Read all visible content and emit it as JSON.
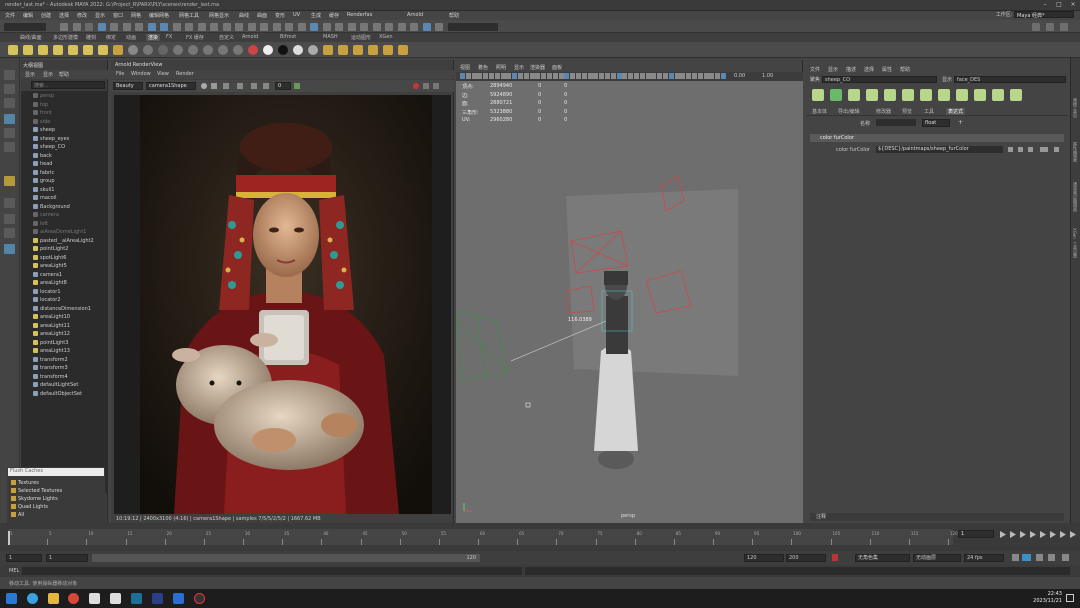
{
  "window": {
    "title": "render_last.ma* - Autodesk MAYA 2022: G:\\Project_R\\PARX\\PLY\\scenes\\render_last.ma"
  },
  "menu": [
    "文件",
    "编辑",
    "创建",
    "选择",
    "修改",
    "显示",
    "窗口",
    "网格",
    "编辑网格",
    "网格工具",
    "网格显示",
    "曲线",
    "曲面",
    "变形",
    "UV",
    "生成",
    "缓存",
    "Renderfax",
    "Arnold",
    "帮助"
  ],
  "workspace": {
    "label": "工作区:",
    "value": "Maya 经典*"
  },
  "shelf_tabs": [
    {
      "label": "曲线/曲面"
    },
    {
      "label": "多边形建模"
    },
    {
      "label": "雕刻"
    },
    {
      "label": "绑定"
    },
    {
      "label": "动画"
    },
    {
      "label": "渲染",
      "active": true
    },
    {
      "label": "FX"
    },
    {
      "label": "FX 缓存"
    },
    {
      "label": "自定义"
    },
    {
      "label": "Arnold"
    },
    {
      "label": "Bifrost"
    },
    {
      "label": "MASH"
    },
    {
      "label": "运动图形"
    },
    {
      "label": "XGen"
    }
  ],
  "outliner": {
    "title": "大纲视图",
    "menu": [
      "显示",
      "显示",
      "帮助"
    ],
    "search_placeholder": "搜索...",
    "items": [
      {
        "name": "persp",
        "dim": true,
        "color": "#666"
      },
      {
        "name": "top",
        "dim": true,
        "color": "#666"
      },
      {
        "name": "front",
        "dim": true,
        "color": "#666"
      },
      {
        "name": "side",
        "dim": true,
        "color": "#666"
      },
      {
        "name": "sheep",
        "color": "#8aa0b8"
      },
      {
        "name": "sheep_eyes",
        "color": "#8aa0b8"
      },
      {
        "name": "sheep_CO",
        "color": "#8aa0b8"
      },
      {
        "name": "back",
        "color": "#8aa0b8"
      },
      {
        "name": "head",
        "color": "#8aa0b8"
      },
      {
        "name": "fabric",
        "color": "#8aa0b8"
      },
      {
        "name": "group",
        "color": "#8aa0b8"
      },
      {
        "name": "skull1",
        "color": "#8aa0b8"
      },
      {
        "name": "macoil",
        "color": "#8aa0b8"
      },
      {
        "name": "Background",
        "color": "#8aa0b8"
      },
      {
        "name": "camera",
        "dim": true,
        "color": "#666"
      },
      {
        "name": "left",
        "dim": true,
        "color": "#666"
      },
      {
        "name": "aiAreaDomeLight1",
        "dim": true,
        "color": "#666"
      },
      {
        "name": "pasted__aiAreaLight2",
        "color": "#d6c25a"
      },
      {
        "name": "pointLight2",
        "color": "#d6c25a"
      },
      {
        "name": "spotLight6",
        "color": "#d6c25a"
      },
      {
        "name": "areaLight5",
        "color": "#d6c25a"
      },
      {
        "name": "camera1",
        "color": "#8aa0b8"
      },
      {
        "name": "areaLight8",
        "color": "#d6c25a"
      },
      {
        "name": "locator1",
        "color": "#8aa0b8"
      },
      {
        "name": "locator2",
        "color": "#8aa0b8"
      },
      {
        "name": "distanceDimension1",
        "color": "#8aa0b8"
      },
      {
        "name": "areaLight10",
        "color": "#d6c25a"
      },
      {
        "name": "areaLight11",
        "color": "#d6c25a"
      },
      {
        "name": "areaLight12",
        "color": "#d6c25a"
      },
      {
        "name": "pointLight3",
        "color": "#d6c25a"
      },
      {
        "name": "areaLight13",
        "color": "#d6c25a"
      },
      {
        "name": "transform2",
        "color": "#8aa0b8"
      },
      {
        "name": "transform3",
        "color": "#8aa0b8"
      },
      {
        "name": "transform4",
        "color": "#8aa0b8"
      },
      {
        "name": "defaultLightSet",
        "color": "#8aa0b8"
      },
      {
        "name": "defaultObjectSet",
        "color": "#8aa0b8"
      }
    ]
  },
  "flush_caches": {
    "input": "Flush Caches",
    "items": [
      "Textures",
      "Selected Textures",
      "Skydome Lights",
      "Quad Lights",
      "All"
    ]
  },
  "render_view": {
    "title": "Arnold RenderView",
    "menu": [
      "File",
      "Window",
      "View",
      "Render"
    ],
    "aov": "Beauty",
    "camera": "camera1Shape",
    "exposure": "0",
    "status": "10:19:12 | 2400x3100 (4:16) | camera1Shape | samples 7/5/5/2/5/2 | 1667.62 MB"
  },
  "viewport": {
    "menu": [
      "视图",
      "着色",
      "照明",
      "显示",
      "渲染器",
      "面板"
    ],
    "hud": [
      {
        "label": "顶点:",
        "v1": "2894940",
        "v2": "0",
        "v3": "0"
      },
      {
        "label": "边:",
        "v1": "5924890",
        "v2": "0",
        "v3": "0"
      },
      {
        "label": "面:",
        "v1": "2880721",
        "v2": "0",
        "v3": "0"
      },
      {
        "label": "三角形:",
        "v1": "5323880",
        "v2": "0",
        "v3": "0"
      },
      {
        "label": "UV:",
        "v1": "2960280",
        "v2": "0",
        "v3": "0"
      }
    ],
    "field1": "0.00",
    "field2": "1.00",
    "distance_label": "116.0389",
    "camera_label": "persp"
  },
  "attribute_editor": {
    "menu": [
      "文件",
      "显示",
      "描述",
      "选择",
      "属性",
      "帮助"
    ],
    "focus_label": "聚焦",
    "focus_value": "sheep_CO",
    "node_label": "显示",
    "node_value": "face_DES",
    "tabs": [
      {
        "label": "基本体"
      },
      {
        "label": "导出/编辑"
      },
      {
        "label": "修改器"
      },
      {
        "label": "预览"
      },
      {
        "label": "工具"
      },
      {
        "label": "表达式",
        "active": true
      }
    ],
    "name_label": "名称",
    "type_value": "float",
    "section": "color furColor",
    "attr_label": "color furColor",
    "attr_value": "${DESC}/paintmaps/sheep_furColor",
    "notes": "注释"
  },
  "right_sidebar": [
    "建模工具包",
    "属性编辑器",
    "通道盒/层编辑器",
    "XGen",
    "工具设置"
  ],
  "timeline": {
    "ticks": [
      "1",
      "5",
      "10",
      "15",
      "20",
      "25",
      "30",
      "35",
      "40",
      "45",
      "50",
      "55",
      "60",
      "65",
      "70",
      "75",
      "80",
      "85",
      "90",
      "95",
      "100",
      "105",
      "110",
      "115",
      "120"
    ],
    "current": "1"
  },
  "range": {
    "start": "1",
    "start2": "1",
    "mid": "120",
    "end1": "120",
    "end2": "200",
    "char_set": "无角色集",
    "anim_layer": "无动画层",
    "fps": "24 fps"
  },
  "mel": {
    "label": "MEL"
  },
  "helpline": "移动工具: 使用操纵器移动对象",
  "clock": {
    "time": "22:43",
    "date": "2023/11/21"
  }
}
